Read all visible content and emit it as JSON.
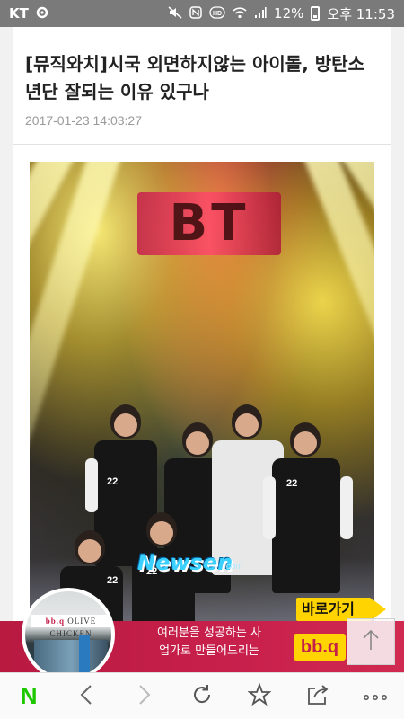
{
  "status_bar": {
    "carrier": "KT",
    "battery_percent": "12%",
    "time": "오후 11:53",
    "icons": [
      "settings-icon",
      "mute-icon",
      "nfc-icon",
      "hd-icon",
      "wifi-icon",
      "signal-icon",
      "battery-icon"
    ]
  },
  "article": {
    "title": "[뮤직와치]시국 외면하지않는 아이돌, 방탄소년단 잘되는 이유 있구나",
    "date": "2017-01-23 14:03:27",
    "photo": {
      "stage_logo": "BT",
      "watermark": "Newsen",
      "watermark_sub": ".com",
      "jersey_numbers": [
        "22",
        "22",
        "22",
        "22"
      ]
    }
  },
  "ad": {
    "store_sign": "OLIVE CHICKEN",
    "store_sign_prefix": "bb.q",
    "text_line1": "여러분을 성공하는 사",
    "text_line2": "업가로 만들어드리는",
    "badge": "바로가기",
    "logo": "bb.q",
    "colors": {
      "background": "#c4204a",
      "badge": "#ffd400"
    }
  },
  "scroll_top": {
    "icon": "arrow-up-icon"
  },
  "bottom_nav": {
    "home_logo": "N",
    "items": [
      "back-icon",
      "forward-icon",
      "refresh-icon",
      "bookmark-icon",
      "share-icon",
      "more-icon"
    ],
    "colors": {
      "home_logo": "#1ec800"
    }
  }
}
